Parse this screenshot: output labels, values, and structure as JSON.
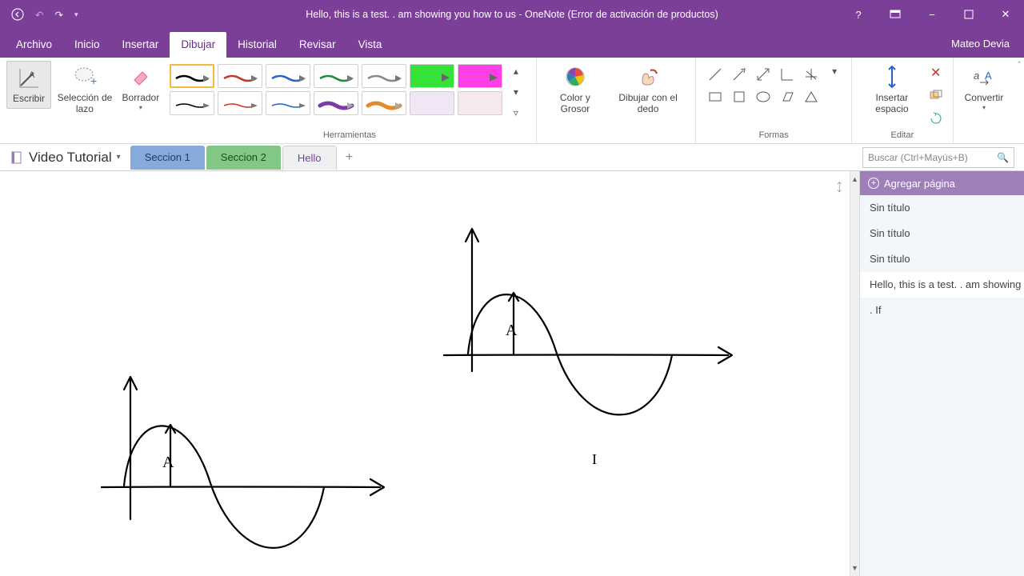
{
  "title": "Hello, this is a test. . am showing  you how to us - OneNote (Error de activación de productos)",
  "user": "Mateo Devia",
  "menu": {
    "archivo": "Archivo",
    "inicio": "Inicio",
    "insertar": "Insertar",
    "dibujar": "Dibujar",
    "historial": "Historial",
    "revisar": "Revisar",
    "vista": "Vista"
  },
  "ribbon": {
    "escribir": "Escribir",
    "lasso": "Selección de lazo",
    "borrador": "Borrador",
    "herramientas": "Herramientas",
    "color": "Color y Grosor",
    "dedo": "Dibujar con el dedo",
    "formas": "Formas",
    "espacio": "Insertar espacio",
    "editar": "Editar",
    "convertir": "Convertir"
  },
  "notebook": {
    "name": "Video Tutorial"
  },
  "sections": {
    "s1": "Seccion 1",
    "s2": "Seccion 2",
    "s3": "Hello"
  },
  "search_placeholder": "Buscar (Ctrl+Mayús+B)",
  "pages": {
    "add": "Agregar página",
    "p1": "Sin título",
    "p2": "Sin título",
    "p3": "Sin título",
    "p4": "Hello, this is a test. . am showing  y",
    "p5": ". If"
  }
}
